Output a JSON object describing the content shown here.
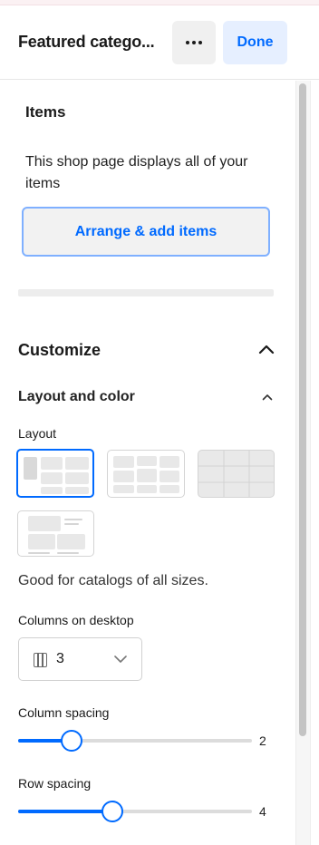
{
  "header": {
    "title": "Featured catego...",
    "done_label": "Done"
  },
  "items_section": {
    "title": "Items",
    "description": "This shop page displays all of your items",
    "arrange_button": "Arrange & add items"
  },
  "customize": {
    "title": "Customize",
    "layout_and_color": {
      "title": "Layout and color",
      "layout_label": "Layout",
      "layout_options": [
        "grid-with-featured",
        "mixed-grid",
        "table-grid",
        "list-with-details"
      ],
      "selected_layout_index": 0,
      "layout_hint": "Good for catalogs of all sizes.",
      "columns_label": "Columns on desktop",
      "columns_value": "3",
      "column_spacing_label": "Column spacing",
      "column_spacing_value": "2",
      "column_spacing_fraction": 0.23,
      "row_spacing_label": "Row spacing",
      "row_spacing_value": "4",
      "row_spacing_fraction": 0.405
    }
  },
  "colors": {
    "accent": "#006aff",
    "done_bg": "#e6efff"
  },
  "icons": {
    "more": "more-horizontal-icon",
    "collapse": "chevron-up-icon",
    "columns": "columns-icon",
    "dropdown": "chevron-down-icon"
  }
}
